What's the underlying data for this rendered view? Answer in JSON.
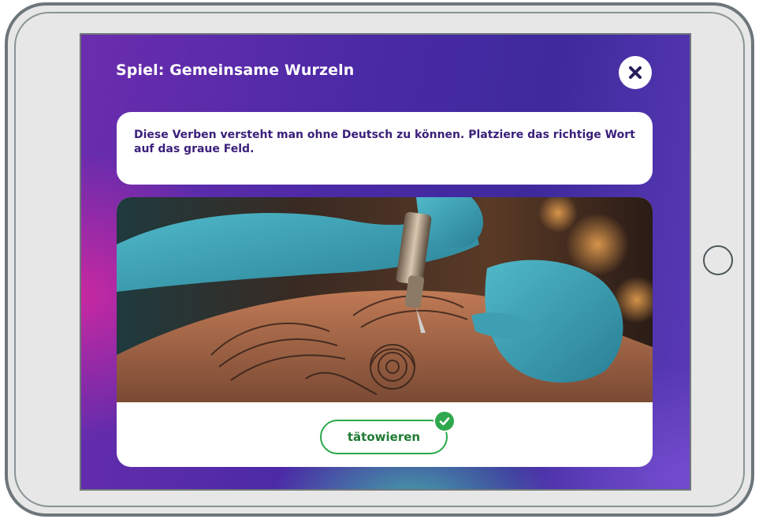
{
  "game": {
    "title": "Spiel: Gemeinsame Wurzeln",
    "instruction": "Diese Verben versteht man ohne Deutsch zu können. Platziere das richtige Wort auf das graue Feld.",
    "answer": "tätowieren",
    "answer_state": "correct"
  },
  "icons": {
    "close": "close-icon",
    "check": "check-icon",
    "home": "home-button"
  },
  "colors": {
    "accent_purple": "#4c2aa6",
    "text_purple": "#3a1f7a",
    "success_green": "#2fa84d"
  }
}
